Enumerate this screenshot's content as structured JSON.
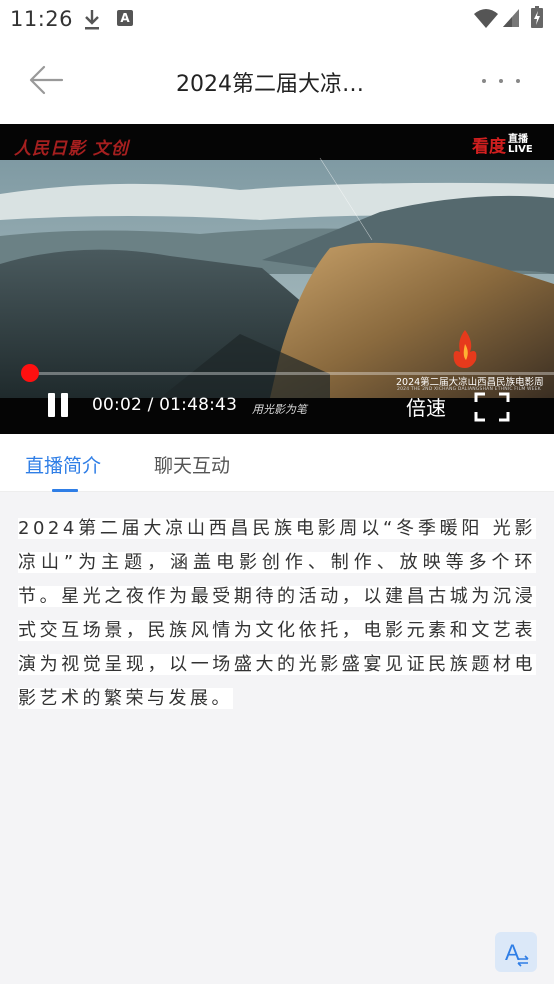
{
  "status_bar": {
    "time": "11:26",
    "icons": [
      "download-icon",
      "font-app-icon",
      "wifi-icon",
      "signal-icon",
      "battery-charging-icon"
    ]
  },
  "nav": {
    "title": "2024第二届大凉…",
    "back_icon": "arrow-left-icon",
    "more_icon": "more-dots-icon"
  },
  "video": {
    "logo_left": "人民日影 文创",
    "logo_right_main": "看度",
    "logo_right_side_1": "直播",
    "logo_right_side_2": "LIVE",
    "festival_caption": "2024第二届大凉山西昌民族电影周",
    "festival_caption_en": "2024 THE 2ND XICHANG DALIANGSHAN ETHNIC FILM WEEK",
    "slogan": "用光影为笔",
    "current_time": "00:02",
    "separator": " / ",
    "duration": "01:48:43",
    "progress_fraction": 0.001,
    "speed_label": "倍速",
    "accent_color": "#e01111"
  },
  "tabs": [
    {
      "label": "直播简介",
      "active": true
    },
    {
      "label": "聊天互动",
      "active": false
    }
  ],
  "content": {
    "intro_text": "2024第二届大凉山西昌民族电影周以“冬季暖阳 光影凉山”为主题，涵盖电影创作、制作、放映等多个环节。星光之夜作为最受期待的活动，以建昌古城为沉浸式交互场景，民族风情为文化依托，电影元素和文艺表演为视觉呈现，以一场盛大的光影盛宴见证民族题材电影艺术的繁荣与发展。"
  },
  "colors": {
    "accent_blue": "#2f7ee6",
    "background": "#f4f4f6"
  },
  "font_button_icon": "font-size-icon"
}
